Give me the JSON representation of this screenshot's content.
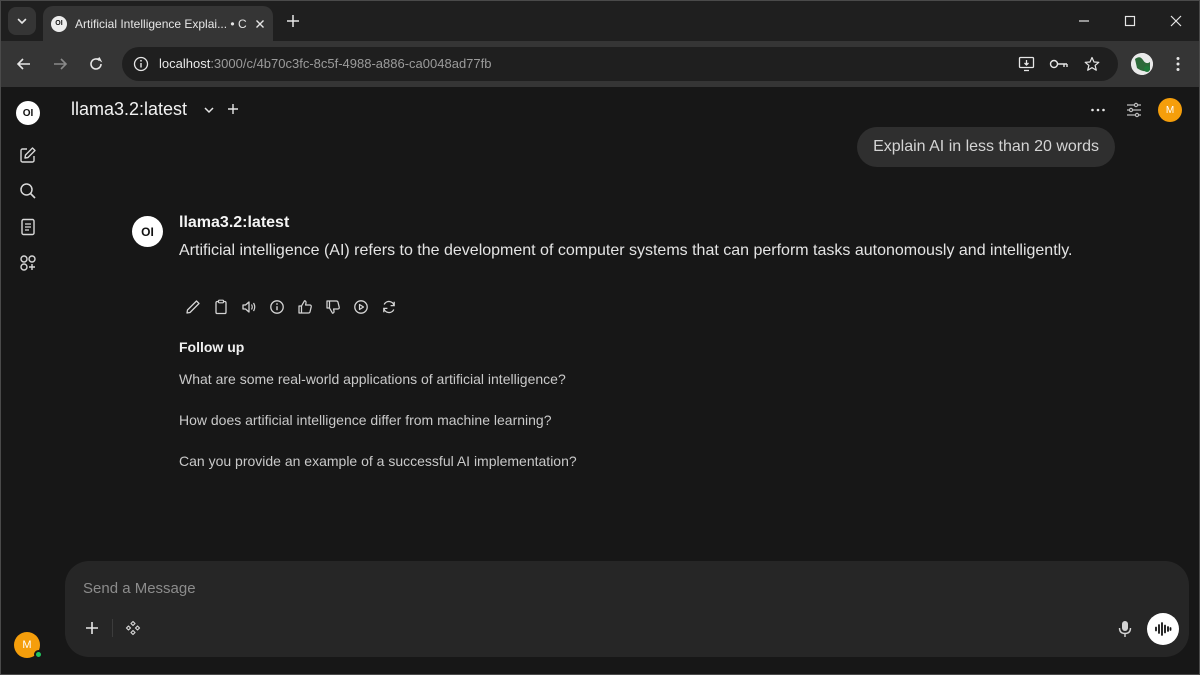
{
  "browser": {
    "tab_title": "Artificial Intelligence Explai... • C",
    "tab_favicon": "OI",
    "url_host": "localhost",
    "url_path": ":3000/c/4b70c3fc-8c5f-4988-a886-ca0048ad77fb"
  },
  "sidebar": {
    "logo": "OI",
    "items": [
      {
        "icon": "new-chat-icon"
      },
      {
        "icon": "search-icon"
      },
      {
        "icon": "notes-icon"
      },
      {
        "icon": "workspace-icon"
      }
    ],
    "user_initial": "M"
  },
  "header": {
    "model_name": "llama3.2:latest",
    "user_initial": "M"
  },
  "chat": {
    "user_message": "Explain AI in less than 20 words",
    "assistant": {
      "avatar": "OI",
      "name": "llama3.2:latest",
      "text": "Artificial intelligence (AI) refers to the development of computer systems that can perform tasks autonomously and intelligently."
    },
    "followup_title": "Follow up",
    "followups": [
      "What are some real-world applications of artificial intelligence?",
      "How does artificial intelligence differ from machine learning?",
      "Can you provide an example of a successful AI implementation?"
    ]
  },
  "composer": {
    "placeholder": "Send a Message"
  },
  "colors": {
    "background": "#171717",
    "bubble": "#2f2f2f",
    "composer": "#262626",
    "avatar": "#f59e0b",
    "online": "#22c55e"
  }
}
